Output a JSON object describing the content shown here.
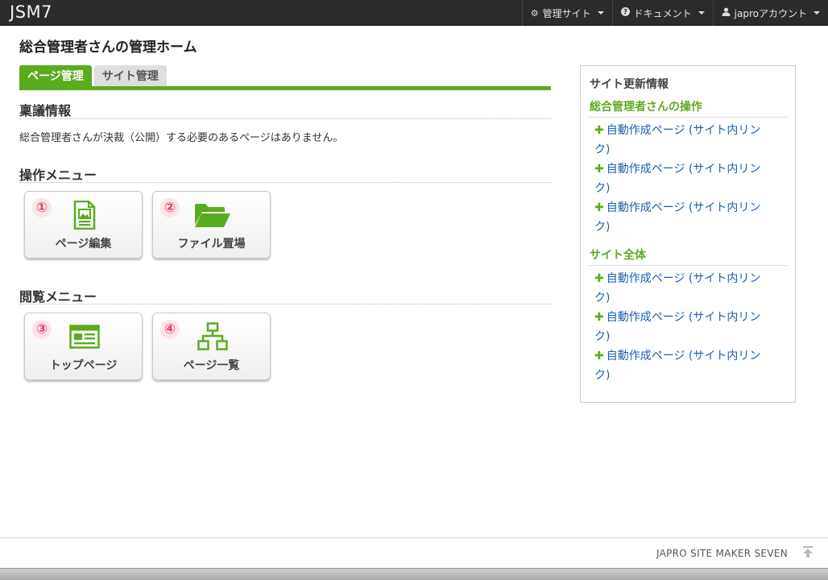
{
  "app": {
    "logo": "JSM7"
  },
  "nav": [
    {
      "icon": "gear-icon",
      "glyph": "⚙",
      "label": "管理サイト"
    },
    {
      "icon": "question-circle-icon",
      "glyph": "❓",
      "label": "ドキュメント"
    },
    {
      "icon": "user-icon",
      "glyph": "👤",
      "label": "japroアカウント"
    }
  ],
  "page": {
    "title": "総合管理者さんの管理ホーム"
  },
  "tabs": [
    {
      "label": "ページ管理",
      "active": true
    },
    {
      "label": "サイト管理",
      "active": false
    }
  ],
  "approval": {
    "heading": "稟議情報",
    "message": "総合管理者さんが決裁（公開）する必要のあるページはありません。"
  },
  "operation_menu": {
    "heading": "操作メニュー",
    "tiles": [
      {
        "num": "①",
        "label": "ページ編集",
        "icon": "page-edit-icon"
      },
      {
        "num": "②",
        "label": "ファイル置場",
        "icon": "folder-open-icon"
      }
    ]
  },
  "browse_menu": {
    "heading": "閲覧メニュー",
    "tiles": [
      {
        "num": "③",
        "label": "トップページ",
        "icon": "browser-window-icon"
      },
      {
        "num": "④",
        "label": "ページ一覧",
        "icon": "sitemap-icon"
      }
    ]
  },
  "sidebar": {
    "title": "サイト更新情報",
    "sections": [
      {
        "heading": "総合管理者さんの操作",
        "links": [
          {
            "line1": "自動作成ページ (サイト内リン",
            "line2": "ク)"
          },
          {
            "line1": "自動作成ページ (サイト内リン",
            "line2": "ク)"
          },
          {
            "line1": "自動作成ページ (サイト内リン",
            "line2": "ク)"
          }
        ]
      },
      {
        "heading": "サイト全体",
        "links": [
          {
            "line1": "自動作成ページ (サイト内リン",
            "line2": "ク)"
          },
          {
            "line1": "自動作成ページ (サイト内リン",
            "line2": "ク)"
          },
          {
            "line1": "自動作成ページ (サイト内リン",
            "line2": "ク)"
          }
        ]
      }
    ]
  },
  "footer": {
    "text": "JAPRO SITE MAKER SEVEN"
  },
  "colors": {
    "accent": "#5bab1f",
    "link": "#1a5fb4",
    "navbar": "#2b2b2b",
    "number": "#e0456b"
  }
}
